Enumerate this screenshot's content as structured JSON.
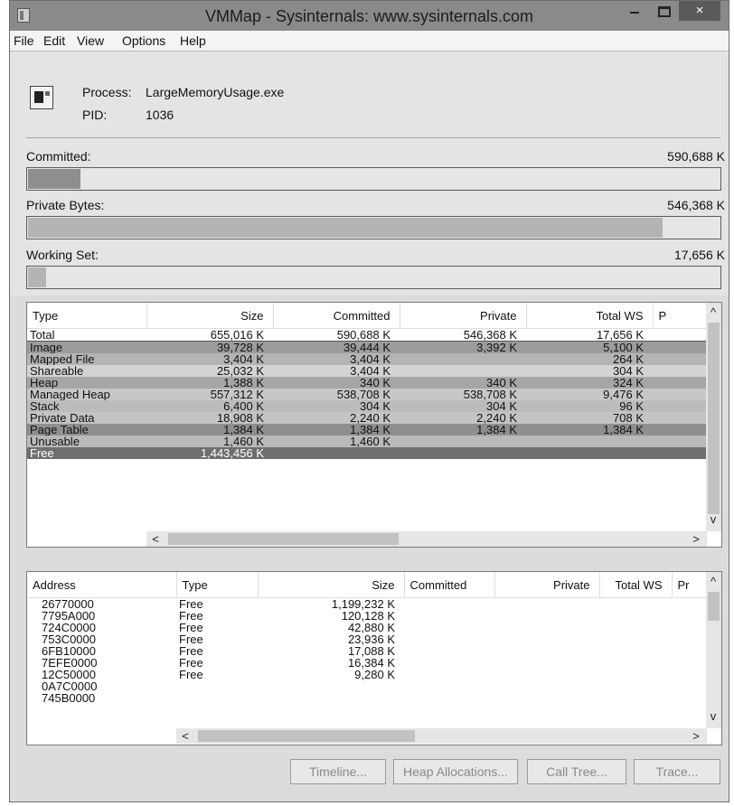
{
  "window": {
    "title": "VMMap - Sysinternals: www.sysinternals.com",
    "close_glyph": "×"
  },
  "menu": [
    "File",
    "Edit",
    "View",
    "Options",
    "Help"
  ],
  "process": {
    "process_label": "Process:",
    "process_name": "LargeMemoryUsage.exe",
    "pid_label": "PID:",
    "pid": "1036"
  },
  "meters": {
    "committed": {
      "label": "Committed:",
      "value": "590,688 K",
      "fill_fraction": 0.075
    },
    "private_bytes": {
      "label": "Private Bytes:",
      "value": "546,368 K",
      "fill_fraction": 0.915
    },
    "working_set": {
      "label": "Working Set:",
      "value": "17,656 K",
      "fill_fraction": 0.026
    }
  },
  "summary": {
    "columns": [
      "Type",
      "Size",
      "Committed",
      "Private",
      "Total WS",
      "P"
    ],
    "rows": [
      [
        "Total",
        "655,016 K",
        "590,688 K",
        "546,368 K",
        "17,656 K",
        ""
      ],
      [
        "Image",
        "39,728 K",
        "39,444 K",
        "3,392 K",
        "5,100 K",
        ""
      ],
      [
        "Mapped File",
        "3,404 K",
        "3,404 K",
        "",
        "264 K",
        ""
      ],
      [
        "Shareable",
        "25,032 K",
        "3,404 K",
        "",
        "304 K",
        ""
      ],
      [
        "Heap",
        "1,388 K",
        "340 K",
        "340 K",
        "324 K",
        ""
      ],
      [
        "Managed Heap",
        "557,312 K",
        "538,708 K",
        "538,708 K",
        "9,476 K",
        ""
      ],
      [
        "Stack",
        "6,400 K",
        "304 K",
        "304 K",
        "96 K",
        ""
      ],
      [
        "Private Data",
        "18,908 K",
        "2,240 K",
        "2,240 K",
        "708 K",
        ""
      ],
      [
        "Page Table",
        "1,384 K",
        "1,384 K",
        "1,384 K",
        "1,384 K",
        ""
      ],
      [
        "Unusable",
        "1,460 K",
        "1,460 K",
        "",
        "",
        ""
      ],
      [
        "Free",
        "1,443,456 K",
        "",
        "",
        "",
        ""
      ]
    ],
    "row_colors": [
      "#ffffff",
      "#9c9c9c",
      "#b4b4b4",
      "#d3d3d3",
      "#a6a6a6",
      "#c7c7c7",
      "#bcbcbc",
      "#c4c4c4",
      "#8f8f8f",
      "#b9b9b9",
      "#6f6f6f"
    ]
  },
  "details": {
    "columns": [
      "Address",
      "Type",
      "Size",
      "Committed",
      "Private",
      "Total WS",
      "Pr"
    ],
    "rows": [
      [
        "26770000",
        "Free",
        "1,199,232 K"
      ],
      [
        "7795A000",
        "Free",
        "120,128 K"
      ],
      [
        "724C0000",
        "Free",
        "42,880 K"
      ],
      [
        "753C0000",
        "Free",
        "23,936 K"
      ],
      [
        "6FB10000",
        "Free",
        "17,088 K"
      ],
      [
        "7EFE0000",
        "Free",
        "16,384 K"
      ],
      [
        "12C50000",
        "Free",
        "9,280 K"
      ],
      [
        "0A7C0000",
        "",
        ""
      ],
      [
        "745B0000",
        "",
        ""
      ]
    ]
  },
  "buttons": {
    "timeline": "Timeline...",
    "heap_allocations": "Heap Allocations...",
    "call_tree": "Call Tree...",
    "trace": "Trace..."
  },
  "scroll_glyphs": {
    "up": "^",
    "down": "v",
    "left": "<",
    "right": ">"
  }
}
